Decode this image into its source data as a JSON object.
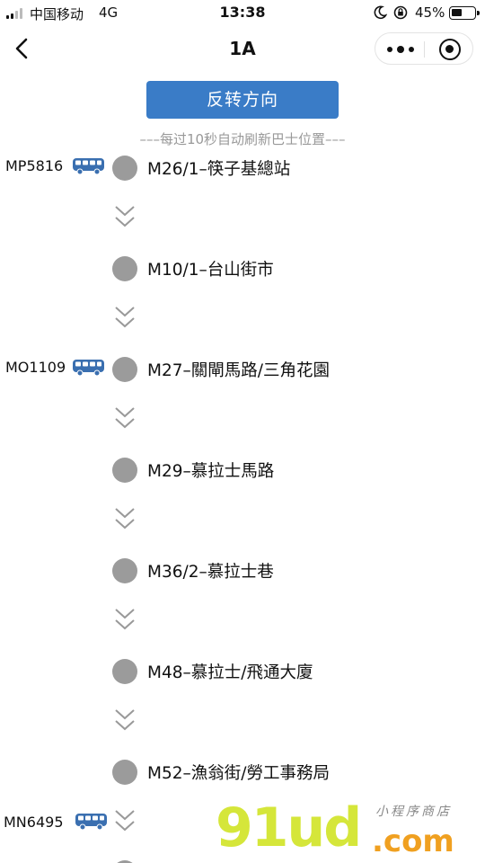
{
  "status_bar": {
    "carrier": "中国移动",
    "network": "4G",
    "time": "13:38",
    "battery_percent": "45%"
  },
  "nav": {
    "title": "1A"
  },
  "actions": {
    "reverse_label": "反转方向",
    "refresh_note": "–––每过10秒自动刷新巴士位置–––"
  },
  "stops": [
    {
      "name": "M26/1–筷子基總站"
    },
    {
      "name": "M10/1–台山街市"
    },
    {
      "name": "M27–關閘馬路/三角花園"
    },
    {
      "name": "M29–慕拉士馬路"
    },
    {
      "name": "M36/2–慕拉士巷"
    },
    {
      "name": "M48–慕拉士/飛通大廈"
    },
    {
      "name": "M52–漁翁街/勞工事務局"
    }
  ],
  "buses": [
    {
      "plate": "MP5816"
    },
    {
      "plate": "MO1109"
    },
    {
      "plate": "MN6495"
    }
  ],
  "watermark": {
    "main": "91ud",
    "domain": ".com",
    "sub": "小程序商店"
  },
  "colors": {
    "accent": "#3a7cc7",
    "stop_dot": "#9b9b9b",
    "bus_icon": "#3a6fb0"
  }
}
